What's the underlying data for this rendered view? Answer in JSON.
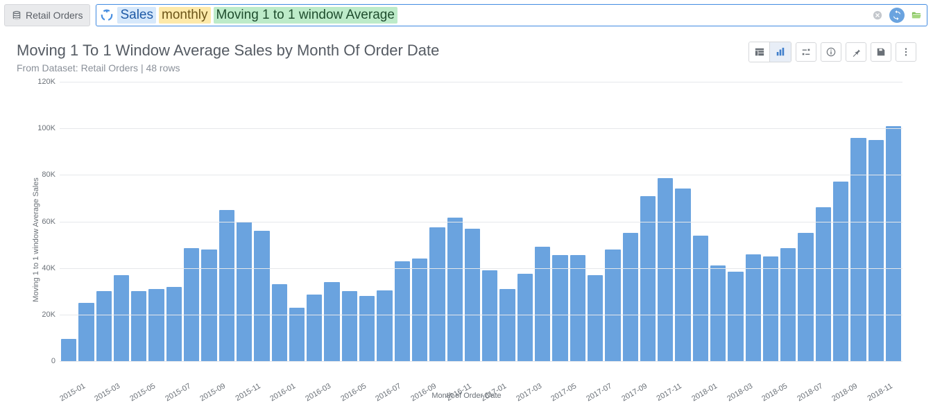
{
  "dataset": {
    "label": "Retail Orders"
  },
  "query": {
    "tokens": {
      "sales": "Sales",
      "monthly": "monthly",
      "window": "Moving 1 to 1 window Average"
    }
  },
  "title": "Moving 1 To 1 Window Average Sales by Month Of Order Date",
  "subtitle": "From Dataset: Retail Orders | 48 rows",
  "chart_data": {
    "type": "bar",
    "title": "Moving 1 To 1 Window Average Sales by Month Of Order Date",
    "xlabel": "Month of Order Date",
    "ylabel": "Moving 1 to 1 window Average Sales",
    "ylim": [
      0,
      120000
    ],
    "yticks": [
      0,
      20000,
      40000,
      60000,
      80000,
      100000,
      120000
    ],
    "ytick_labels": [
      "0",
      "20K",
      "40K",
      "60K",
      "80K",
      "100K",
      "120K"
    ],
    "xtick_labels": [
      "2015-01",
      "2015-03",
      "2015-05",
      "2015-07",
      "2015-09",
      "2015-11",
      "2016-01",
      "2016-03",
      "2016-05",
      "2016-07",
      "2016-09",
      "2016-11",
      "2017-01",
      "2017-03",
      "2017-05",
      "2017-07",
      "2017-09",
      "2017-11",
      "2018-01",
      "2018-03",
      "2018-05",
      "2018-07",
      "2018-09",
      "2018-11"
    ],
    "categories": [
      "2015-01",
      "2015-02",
      "2015-03",
      "2015-04",
      "2015-05",
      "2015-06",
      "2015-07",
      "2015-08",
      "2015-09",
      "2015-10",
      "2015-11",
      "2015-12",
      "2016-01",
      "2016-02",
      "2016-03",
      "2016-04",
      "2016-05",
      "2016-06",
      "2016-07",
      "2016-08",
      "2016-09",
      "2016-10",
      "2016-11",
      "2016-12",
      "2017-01",
      "2017-02",
      "2017-03",
      "2017-04",
      "2017-05",
      "2017-06",
      "2017-07",
      "2017-08",
      "2017-09",
      "2017-10",
      "2017-11",
      "2017-12",
      "2018-01",
      "2018-02",
      "2018-03",
      "2018-04",
      "2018-05",
      "2018-06",
      "2018-07",
      "2018-08",
      "2018-09",
      "2018-10",
      "2018-11",
      "2018-12"
    ],
    "values": [
      9500,
      25000,
      30000,
      37000,
      30000,
      31000,
      32000,
      48500,
      48000,
      65000,
      60000,
      56000,
      33000,
      23000,
      28500,
      34000,
      30000,
      28000,
      30500,
      43000,
      44000,
      57500,
      61500,
      57000,
      39000,
      31000,
      37500,
      49000,
      45500,
      45500,
      37000,
      48000,
      55000,
      71000,
      78500,
      74000,
      54000,
      41000,
      38500,
      46000,
      45000,
      48500,
      55000,
      66000,
      77000,
      96000,
      95000,
      101000
    ]
  },
  "toolbar": {
    "view": {
      "table": "Table view",
      "chart": "Chart view",
      "selected": "chart"
    },
    "settings": "Settings",
    "info": "Info",
    "pin": "Pin",
    "save": "Save",
    "more": "More"
  },
  "icons": {
    "clear": "Clear",
    "refresh": "Refresh",
    "open": "Open"
  },
  "colors": {
    "bar": "#6aa3df",
    "accent": "#4a90e2"
  }
}
